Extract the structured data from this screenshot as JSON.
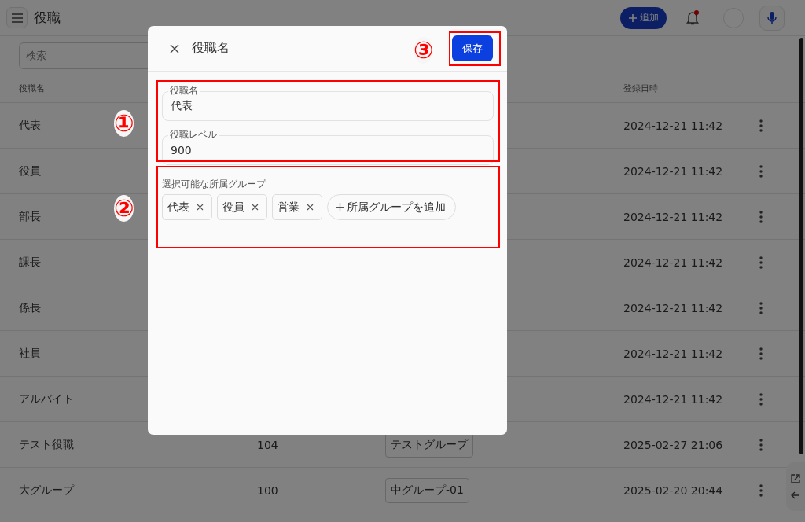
{
  "app_bar": {
    "title": "役職",
    "add_button": "追加"
  },
  "search": {
    "placeholder": "検索"
  },
  "table": {
    "columns": [
      "役職名",
      "登録日時"
    ],
    "rows": [
      {
        "name": "代表",
        "date": "2024-12-21 11:42"
      },
      {
        "name": "役員",
        "date": "2024-12-21 11:42"
      },
      {
        "name": "部長",
        "date": "2024-12-21 11:42"
      },
      {
        "name": "課長",
        "date": "2024-12-21 11:42"
      },
      {
        "name": "係長",
        "date": "2024-12-21 11:42"
      },
      {
        "name": "社員",
        "date": "2024-12-21 11:42"
      },
      {
        "name": "アルバイト",
        "date": "2024-12-21 11:42"
      },
      {
        "name": "テスト役職",
        "level": "104",
        "group": "テストグループ",
        "date": "2025-02-27 21:06"
      },
      {
        "name": "大グループ",
        "level": "100",
        "group": "中グループ-01",
        "date": "2025-02-20 20:44"
      }
    ]
  },
  "dialog": {
    "title": "役職名",
    "save_button": "保存",
    "fields": [
      {
        "label": "役職名",
        "value": "代表"
      },
      {
        "label": "役職レベル",
        "value": "900"
      }
    ],
    "groups_label": "選択可能な所属グループ",
    "groups": [
      "代表",
      "役員",
      "営業"
    ],
    "add_group_button": "所属グループを追加"
  },
  "annotations": [
    "①",
    "②",
    "③"
  ]
}
